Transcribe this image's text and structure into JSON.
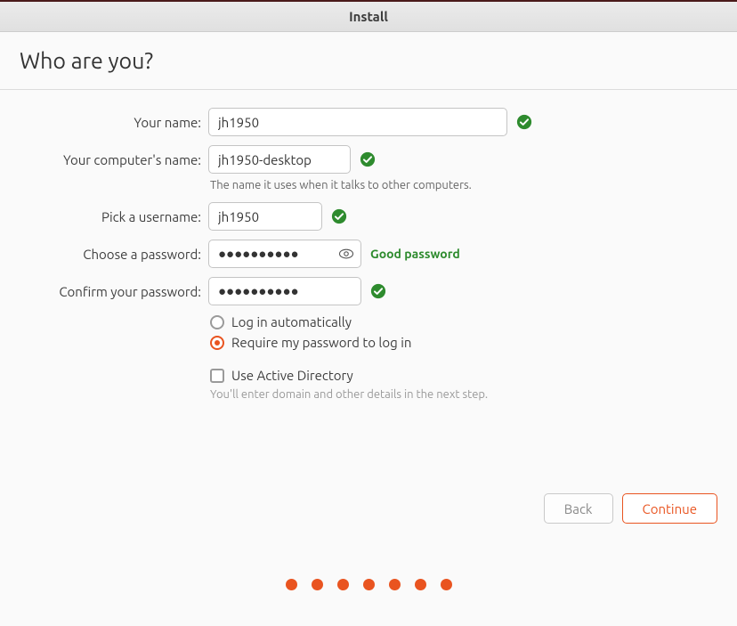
{
  "window": {
    "title": "Install"
  },
  "page": {
    "heading": "Who are you?"
  },
  "labels": {
    "your_name": "Your name:",
    "computer_name": "Your computer's name:",
    "computer_name_hint": "The name it uses when it talks to other computers.",
    "username": "Pick a username:",
    "password": "Choose a password:",
    "confirm": "Confirm your password:",
    "auto_login": "Log in automatically",
    "require_pw": "Require my password to log in",
    "use_ad": "Use Active Directory",
    "ad_hint": "You'll enter domain and other details in the next step."
  },
  "values": {
    "your_name": "jh1950",
    "computer_name": "jh1950-desktop",
    "username": "jh1950",
    "password": "●●●●●●●●●●",
    "confirm": "●●●●●●●●●●",
    "password_strength": "Good password"
  },
  "options": {
    "login_mode": "require_pw",
    "use_ad": false
  },
  "buttons": {
    "back": "Back",
    "continue": "Continue"
  },
  "pager": {
    "count": 7,
    "current": 6
  },
  "icons": {
    "check": "check-circle",
    "eye": "eye"
  },
  "colors": {
    "accent": "#e95420",
    "success": "#2e8b2e"
  }
}
